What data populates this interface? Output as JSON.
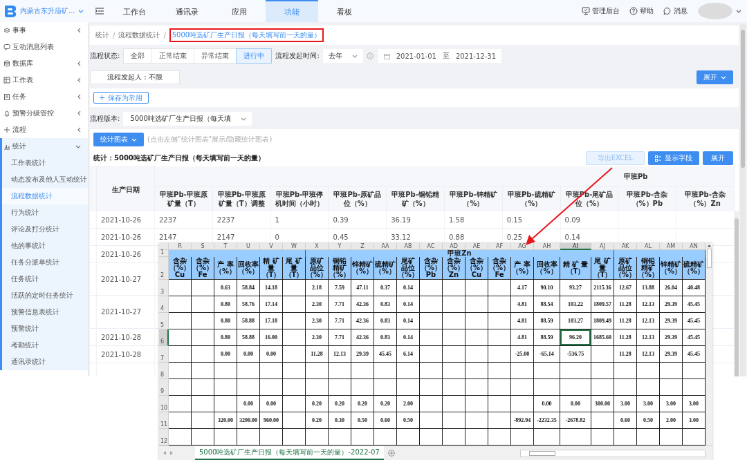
{
  "topbar": {
    "org_name": "内蒙古东升庙矿...",
    "nav_tabs": [
      {
        "label": "工作台",
        "selected": false
      },
      {
        "label": "通讯录",
        "selected": false
      },
      {
        "label": "应用",
        "selected": false
      },
      {
        "label": "功能",
        "selected": true
      },
      {
        "label": "看板",
        "selected": false
      }
    ],
    "actions": [
      "管理后台",
      "帮助",
      "消息"
    ]
  },
  "sidebar": {
    "items": [
      {
        "label": "事事",
        "kind": "group",
        "expanded": false
      },
      {
        "label": "互动消息列表",
        "kind": "link"
      },
      {
        "label": "数据库",
        "kind": "group",
        "expanded": false
      },
      {
        "label": "工作表",
        "kind": "group",
        "expanded": false
      },
      {
        "label": "任务",
        "kind": "group",
        "expanded": false
      },
      {
        "label": "预警分级管控",
        "kind": "group",
        "expanded": false
      },
      {
        "label": "流程",
        "kind": "group",
        "expanded": false
      },
      {
        "label": "统计",
        "kind": "group",
        "expanded": true,
        "children": [
          {
            "label": "工作表统计",
            "selected": false
          },
          {
            "label": "动态发布及他人互动统计",
            "selected": false
          },
          {
            "label": "流程数据统计",
            "selected": true
          },
          {
            "label": "行为统计",
            "selected": false
          },
          {
            "label": "评论及打分统计",
            "selected": false
          },
          {
            "label": "他的事统计",
            "selected": false
          },
          {
            "label": "任务分派单统计",
            "selected": false
          },
          {
            "label": "任务统计",
            "selected": false
          },
          {
            "label": "活跃的定时任务统计",
            "selected": false
          },
          {
            "label": "预警信息表统计",
            "selected": false
          },
          {
            "label": "预警统计",
            "selected": false
          },
          {
            "label": "考勤统计",
            "selected": false
          },
          {
            "label": "通讯录统计",
            "selected": false
          }
        ]
      }
    ]
  },
  "breadcrumb": {
    "separator": "/",
    "items": [
      {
        "label": "统计",
        "current": false,
        "boxed": false
      },
      {
        "label": "流程数据统计",
        "current": false,
        "boxed": false
      },
      {
        "label": "5000吨选矿厂生产日报（每天填写前一天的量）",
        "current": true,
        "boxed": true
      }
    ]
  },
  "status_filter": {
    "label": "流程状态:",
    "options": [
      {
        "label": "全部",
        "selected": false
      },
      {
        "label": "正常结束",
        "selected": false
      },
      {
        "label": "异常结束",
        "selected": false
      },
      {
        "label": "进行中",
        "selected": true
      }
    ]
  },
  "time_filter": {
    "label": "流程发起时间:",
    "value": "去年",
    "start": "2021-01-01",
    "separator": "至",
    "end": "2021-12-31"
  },
  "initiator_filter": "流程发起人：不限",
  "expand_button": "展开",
  "save_button": "保存为常用",
  "version": {
    "label": "流程版本:",
    "value": "5000吨选矿厂生产日报（每天填"
  },
  "chart_toggle": {
    "label": "统计图表",
    "hint": "(点击左侧\"统计图表\"展示/隐藏统计图表)"
  },
  "stats": {
    "title": "统计：5000吨选矿厂生产日报（每天填写前一天的量）",
    "buttons": [
      {
        "label": "导出EXCEL",
        "kind": "export",
        "disabled": true
      },
      {
        "label": "显示字段",
        "kind": "fields",
        "disabled": false
      },
      {
        "label": "展开",
        "kind": "expand",
        "disabled": false
      }
    ],
    "table": {
      "group_label": "甲班Pb",
      "columns": [
        "生产日期",
        "甲班Pb-甲班原矿量（T）",
        "甲班Pb-甲班原矿量（T）调整",
        "甲班Pb-甲班停机时间（小时）",
        "甲班Pb-原矿品位（%）",
        "甲班Pb-铜铅精矿（%）",
        "甲班Pb-锌精矿（%）",
        "甲班Pb-硫精矿（%）",
        "甲班Pb-尾矿品位（%）",
        "甲班Pb-含杂（%）Pb",
        "甲班Pb-含杂（%）Zn"
      ],
      "rows": [
        {
          "cells": [
            "2021-10-26",
            "2237",
            "2237",
            "1",
            "0.39",
            "36.19",
            "1.58",
            "0.15",
            "0.09"
          ]
        },
        {
          "cells": [
            "2021-10-26",
            "2147",
            "2147",
            "0",
            "0.45",
            "33.12",
            "0.88",
            "0.25",
            "0.14"
          ]
        },
        {
          "cells": [
            "2021-10-26"
          ]
        },
        {
          "cells": [
            "2021-10-27"
          ]
        },
        {
          "cells": [
            "2021-10-27"
          ]
        },
        {
          "cells": [
            "2021-10-28"
          ]
        },
        {
          "cells": [
            "2021-10-28"
          ]
        }
      ]
    }
  },
  "annotation": {
    "kind": "arrow"
  },
  "sheet": {
    "columns": [
      {
        "letter": "R",
        "selected": false
      },
      {
        "letter": "S",
        "selected": false
      },
      {
        "letter": "T",
        "selected": false
      },
      {
        "letter": "U",
        "selected": false
      },
      {
        "letter": "V",
        "selected": false
      },
      {
        "letter": "W",
        "selected": false
      },
      {
        "letter": "X",
        "selected": false
      },
      {
        "letter": "Y",
        "selected": false
      },
      {
        "letter": "Z",
        "selected": false
      },
      {
        "letter": "AA",
        "selected": false
      },
      {
        "letter": "AB",
        "selected": false
      },
      {
        "letter": "AC",
        "selected": false
      },
      {
        "letter": "AD",
        "selected": false
      },
      {
        "letter": "AE",
        "selected": false
      },
      {
        "letter": "AF",
        "selected": false
      },
      {
        "letter": "AG",
        "selected": false
      },
      {
        "letter": "AH",
        "selected": false
      },
      {
        "letter": "AI",
        "selected": true
      },
      {
        "letter": "AJ",
        "selected": false
      },
      {
        "letter": "AK",
        "selected": false
      },
      {
        "letter": "AL",
        "selected": false
      },
      {
        "letter": "AM",
        "selected": false
      },
      {
        "letter": "AN",
        "selected": false
      }
    ],
    "band_row": {
      "number": "1",
      "label": "甲班Zn"
    },
    "header_row": {
      "number": "2",
      "cells": [
        [
          "含杂",
          "（%）",
          "Cu"
        ],
        [
          "含杂",
          "（%）",
          "Fe"
        ],
        [
          "产 率",
          "（%）"
        ],
        [
          "回收率",
          "（%）"
        ],
        [
          "精 矿",
          "量",
          "（T）"
        ],
        [
          "尾 矿",
          "量",
          "（T）"
        ],
        [
          "原矿",
          "品位",
          "（%）"
        ],
        [
          "铜铅",
          "精矿",
          "（%）"
        ],
        [
          "锌精矿",
          "（%）"
        ],
        [
          "硫精矿",
          "（%）"
        ],
        [
          "尾矿",
          "品位",
          "（%）"
        ],
        [
          "含杂",
          "（%）",
          "Pb"
        ],
        [
          "含杂",
          "（%）",
          "Zn"
        ],
        [
          "含杂",
          "（%）",
          "Cu"
        ],
        [
          "含杂",
          "（%）",
          "Fe"
        ],
        [
          "产 率",
          "（%）"
        ],
        [
          "回收率",
          "（%）"
        ],
        [
          "精 矿 量",
          "（T）"
        ],
        [
          "尾 矿",
          "量",
          "（T）"
        ],
        [
          "原矿",
          "品位",
          "（%）"
        ],
        [
          "铜铅",
          "精矿",
          "（%）"
        ],
        [
          "锌精矿",
          "（%）"
        ],
        [
          "硫精矿",
          "（%）"
        ]
      ]
    },
    "rows": [
      {
        "number": "3",
        "selected": false,
        "cells": [
          "",
          "",
          "0.63",
          "58.84",
          "14.18",
          "",
          "2.18",
          "7.59",
          "47.11",
          "0.37",
          "0.14",
          "",
          "",
          "",
          "",
          "4.17",
          "90.10",
          "93.27",
          "2115.36",
          "12.67",
          "13.88",
          "26.04",
          "40.48"
        ]
      },
      {
        "number": "4",
        "selected": false,
        "cells": [
          "",
          "",
          "0.80",
          "58.76",
          "17.14",
          "",
          "2.30",
          "7.71",
          "42.36",
          "0.83",
          "0.14",
          "",
          "",
          "",
          "",
          "4.81",
          "88.54",
          "103.22",
          "1809.57",
          "11.28",
          "12.13",
          "29.39",
          "45.45"
        ]
      },
      {
        "number": "5",
        "selected": false,
        "cells": [
          "",
          "",
          "0.80",
          "58.88",
          "17.18",
          "",
          "2.30",
          "7.71",
          "42.36",
          "0.83",
          "0.14",
          "",
          "",
          "",
          "",
          "4.81",
          "88.59",
          "103.27",
          "1809.49",
          "11.28",
          "12.13",
          "29.39",
          "45.45"
        ]
      },
      {
        "number": "6",
        "selected": true,
        "cells": [
          "",
          "",
          "0.80",
          "58.88",
          "16.00",
          "",
          "2.30",
          "7.71",
          "42.36",
          "0.83",
          "0.14",
          "",
          "",
          "",
          "",
          "4.81",
          "88.59",
          "96.20",
          "1685.60",
          "11.28",
          "12.13",
          "29.39",
          "45.45"
        ]
      },
      {
        "number": "7",
        "selected": false,
        "cells": [
          "",
          "",
          "0.00",
          "0.00",
          "0.00",
          "",
          "11.28",
          "12.13",
          "29.39",
          "45.45",
          "6.14",
          "",
          "",
          "",
          "",
          "-25.00",
          "-65.14",
          "-536.75",
          "",
          "11.28",
          "12.13",
          "29.39",
          "45.45"
        ]
      },
      {
        "number": "8",
        "selected": false,
        "cells": []
      },
      {
        "number": "9",
        "selected": false,
        "cells": []
      },
      {
        "number": "10",
        "selected": false,
        "cells": [
          "",
          "",
          "",
          "0.00",
          "0.00",
          "",
          "0.20",
          "0.20",
          "0.20",
          "0.20",
          "2.00",
          "",
          "",
          "",
          "",
          "",
          "0.00",
          "0.00",
          "300.00",
          "3.00",
          "3.00",
          "3.00",
          "3.00"
        ]
      },
      {
        "number": "11",
        "selected": false,
        "cells": [
          "",
          "",
          "320.00",
          "3200.00",
          "960.00",
          "",
          "0.20",
          "0.30",
          "0.50",
          "0.60",
          "0.50",
          "",
          "",
          "",
          "",
          "-892.94",
          "-2232.35",
          "-2678.82",
          "",
          "0.60",
          "0.50",
          "2.00",
          "3.00"
        ]
      },
      {
        "number": "12",
        "selected": false,
        "cells": []
      }
    ],
    "tab": "5000吨选矿厂生产日报（每天填写前一天的量）-2022-07"
  }
}
